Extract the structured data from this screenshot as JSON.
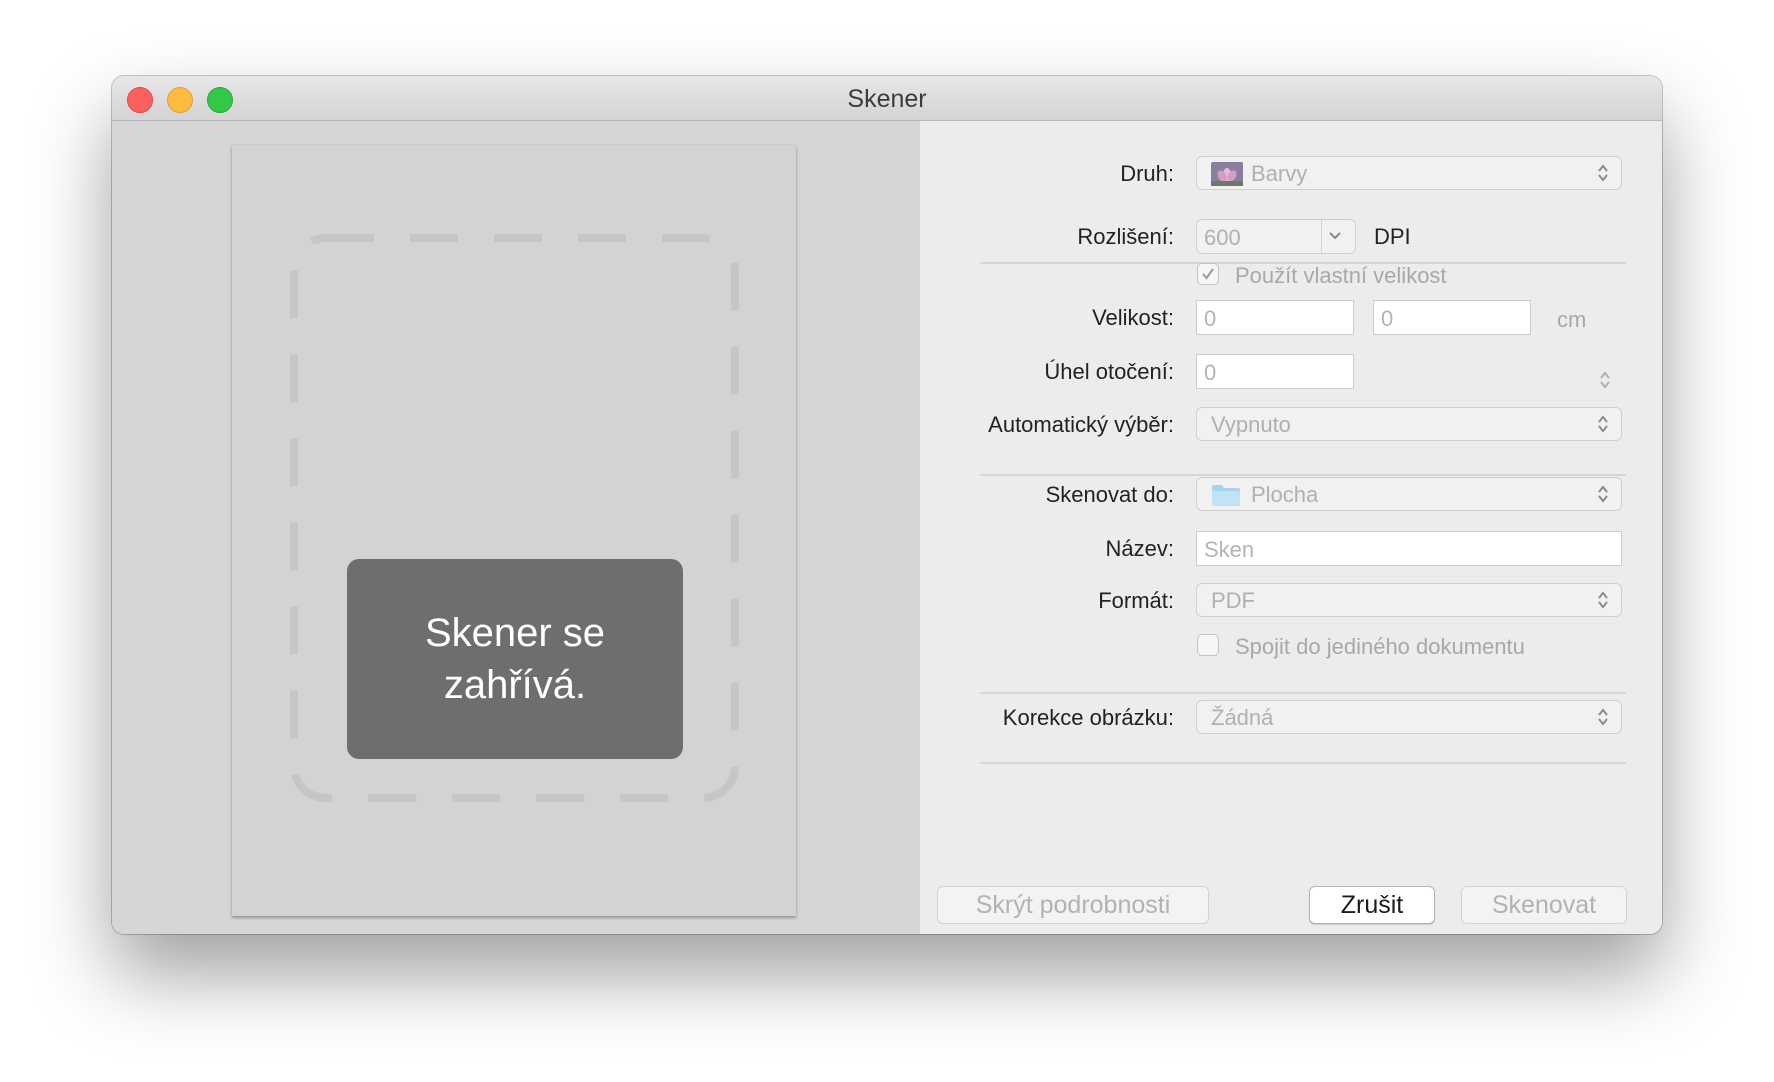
{
  "window": {
    "title": "Skener"
  },
  "preview": {
    "status": "Skener se zahřívá."
  },
  "settings": {
    "kind": {
      "label": "Druh:",
      "value": "Barvy",
      "icon": "colors-flower-icon"
    },
    "resolution": {
      "label": "Rozlišení:",
      "value": "600",
      "unit": "DPI"
    },
    "custom_size": {
      "label": "Použít vlastní velikost",
      "checked": true
    },
    "size": {
      "label": "Velikost:",
      "width": "0",
      "height": "0",
      "unit": "cm"
    },
    "rotation": {
      "label": "Úhel otočení:",
      "value": "0"
    },
    "auto_select": {
      "label": "Automatický výběr:",
      "value": "Vypnuto"
    },
    "scan_to": {
      "label": "Skenovat do:",
      "value": "Plocha",
      "icon": "folder-icon"
    },
    "name": {
      "label": "Název:",
      "placeholder": "Sken"
    },
    "format": {
      "label": "Formát:",
      "value": "PDF"
    },
    "combine": {
      "label": "Spojit do jediného dokumentu",
      "checked": false
    },
    "correction": {
      "label": "Korekce obrázku:",
      "value": "Žádná"
    }
  },
  "buttons": {
    "hide_details": "Skrýt podrobnosti",
    "cancel": "Zrušit",
    "scan": "Skenovat"
  },
  "colors": {
    "close": "#fc605c",
    "minimize": "#fdbc40",
    "maximize": "#34c84a",
    "status_badge": "#6e6e6e"
  }
}
